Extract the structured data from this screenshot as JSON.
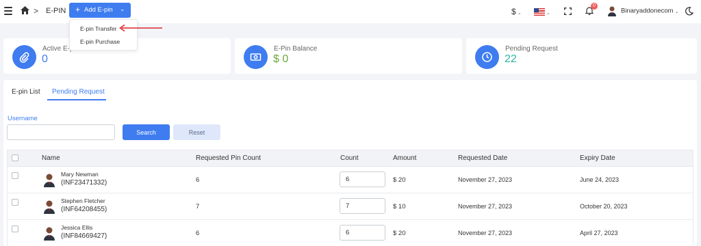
{
  "header": {
    "page_title": "E-PIN",
    "breadcrumb_sep": ">",
    "add_button": {
      "plus": "+",
      "label": "Add E-pin",
      "chevron": "⌄"
    },
    "currency": "$",
    "notification_count": "0",
    "user_name": "Binaryaddonecom"
  },
  "dropdown": {
    "items": [
      "E-pin Transfer",
      "E-pin Purchase"
    ]
  },
  "cards": [
    {
      "title": "Active E-pins",
      "value": "0",
      "value_color": "#3e7cf0",
      "icon": "paperclip-icon"
    },
    {
      "title": "E-Pin Balance",
      "value": "$ 0",
      "value_color": "#6aa83b",
      "icon": "cash-icon"
    },
    {
      "title": "Pending Request",
      "value": "22",
      "value_color": "#2cb5a0",
      "icon": "clock-icon"
    }
  ],
  "tabs": [
    "E-pin List",
    "Pending Request"
  ],
  "form": {
    "username_label": "Username",
    "username_value": "",
    "search": "Search",
    "reset": "Reset"
  },
  "table": {
    "headers": [
      "Name",
      "Requested Pin Count",
      "Count",
      "Amount",
      "Requested Date",
      "Expiry Date"
    ],
    "rows": [
      {
        "name": "Mary Newman",
        "code": "(INF23471332)",
        "requested": "6",
        "count": "6",
        "amount": "$ 20",
        "requested_date": "November 27, 2023",
        "expiry_date": "June 24, 2023"
      },
      {
        "name": "Stephen Fletcher",
        "code": "(INF64208455)",
        "requested": "7",
        "count": "7",
        "amount": "$ 10",
        "requested_date": "November 27, 2023",
        "expiry_date": "October 20, 2023"
      },
      {
        "name": "Jessica Ellis",
        "code": "(INF84669427)",
        "requested": "6",
        "count": "6",
        "amount": "$ 20",
        "requested_date": "November 27, 2023",
        "expiry_date": "April 27, 2023"
      }
    ]
  },
  "colors": {
    "accent": "#3e7cf0",
    "badge": "#f15c5c",
    "arrow": "#d9262c"
  }
}
